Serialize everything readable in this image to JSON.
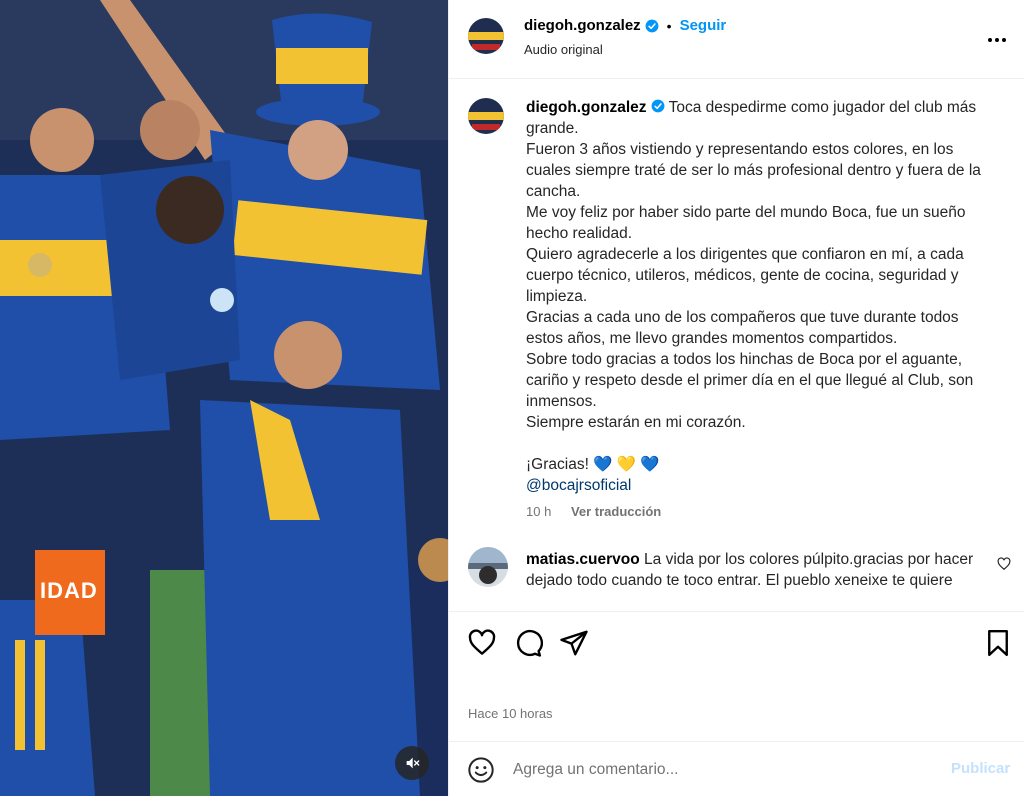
{
  "post": {
    "author": {
      "username": "diegoh.gonzalez",
      "verified": true,
      "follow_label": "Seguir",
      "audio_label": "Audio original"
    },
    "caption": {
      "username": "diegoh.gonzalez",
      "lines": [
        "Toca despedirme como jugador del club más grande.",
        "Fueron 3 años vistiendo y representando estos colores, en los cuales siempre traté de ser lo más profesional dentro y fuera de la cancha.",
        "Me voy feliz por haber sido parte del mundo Boca, fue un sueño hecho realidad.",
        "Quiero agradecerle a los dirigentes que confiaron en mí, a cada cuerpo técnico, utileros, médicos, gente de cocina, seguridad y limpieza.",
        "Gracias a cada uno de los compañeros que tuve durante todos estos años, me llevo grandes momentos compartidos.",
        "Sobre todo gracias a todos los hinchas de Boca por el aguante, cariño y respeto desde el primer día en el que llegué al Club, son inmensos.",
        "Siempre estarán en mi corazón."
      ],
      "closing": "¡Gracias! 💙 💛 💙",
      "mention": "@bocajrsoficial",
      "age": "10 h",
      "translate_label": "Ver traducción"
    },
    "comments": [
      {
        "username": "matias.cuervoo",
        "text": "La vida por los colores púlpito.gracias por hacer dejado todo cuando te toco entrar. El pueblo xeneixe te quiere"
      }
    ],
    "timestamp": "Hace 10 horas",
    "composer": {
      "placeholder": "Agrega un comentario...",
      "publish_label": "Publicar"
    },
    "media": {
      "sign_text": "IDAD"
    },
    "icons": {
      "verified": "verified-badge-icon",
      "more": "more-options-icon",
      "like": "heart-icon",
      "comment": "comment-bubble-icon",
      "share": "paper-plane-icon",
      "save": "bookmark-icon",
      "emoji": "smiley-icon",
      "mute": "speaker-muted-icon"
    },
    "colors": {
      "accent": "#0095f6",
      "boca_blue": "#1f4fa8",
      "boca_gold": "#f3c233",
      "muted_text": "#737373"
    }
  }
}
